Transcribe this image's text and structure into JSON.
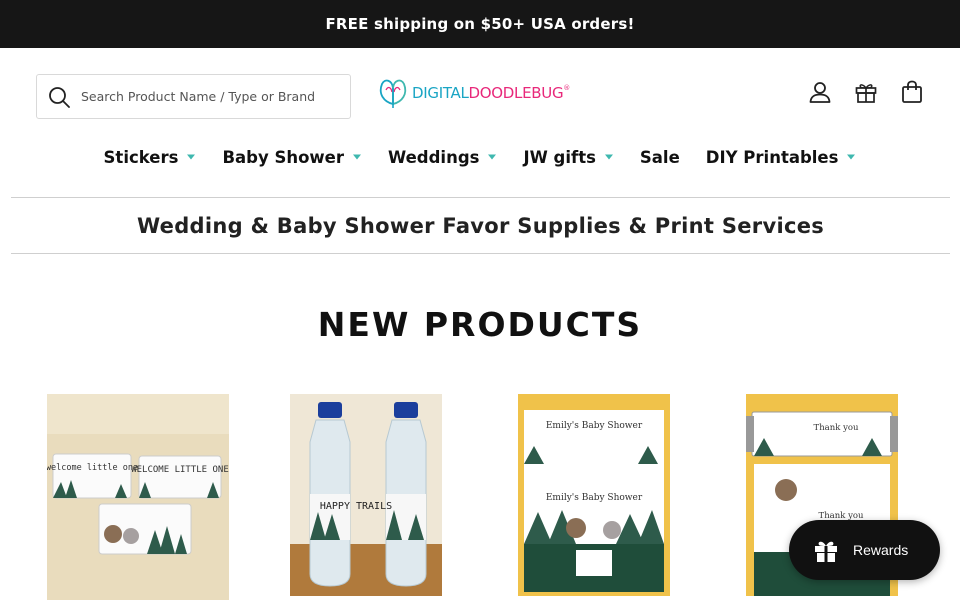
{
  "announcement": "FREE shipping on $50+ USA orders!",
  "search": {
    "placeholder": "Search Product Name / Type or Brand"
  },
  "logo": {
    "part1": "DIGITAL",
    "part2": "DOODLEBUG",
    "mark": "®"
  },
  "header_icons": [
    "account-icon",
    "gift-icon",
    "cart-icon"
  ],
  "nav": [
    {
      "label": "Stickers",
      "has_dropdown": true
    },
    {
      "label": "Baby Shower",
      "has_dropdown": true
    },
    {
      "label": "Weddings",
      "has_dropdown": true
    },
    {
      "label": "JW gifts",
      "has_dropdown": true
    },
    {
      "label": "Sale",
      "has_dropdown": false
    },
    {
      "label": "DIY Printables",
      "has_dropdown": true
    }
  ],
  "tagline": "Wedding & Baby Shower Favor Supplies & Print Services",
  "section_title": "NEW PRODUCTS",
  "products": [
    {
      "texts": [
        "welcome little one",
        "WELCOME LITTLE ONE"
      ]
    },
    {
      "texts": [
        "HAPPY TRAILS"
      ]
    },
    {
      "texts": [
        "Emily's Baby Shower"
      ]
    },
    {
      "texts": [
        "Thank you",
        "Thank you"
      ]
    }
  ],
  "rewards": {
    "label": "Rewards"
  },
  "colors": {
    "accent_teal": "#3fb8af",
    "bar": "#161616",
    "logo_blue": "#1aa5c4",
    "logo_pink": "#e8287a"
  }
}
